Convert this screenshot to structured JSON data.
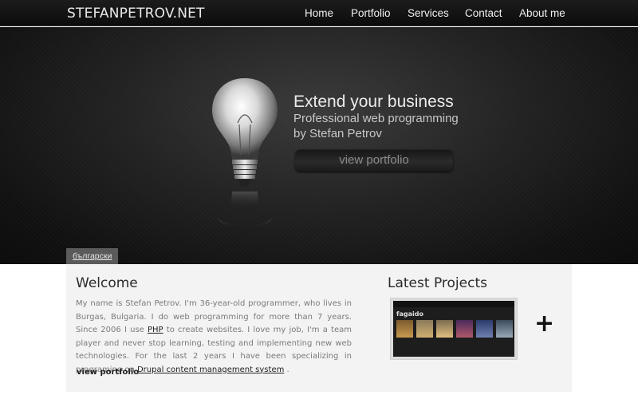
{
  "site": {
    "logo": "STEFANPETROV.NET"
  },
  "nav": {
    "items": [
      "Home",
      "Portfolio",
      "Services",
      "Contact",
      "About me"
    ]
  },
  "hero": {
    "headline": "Extend your business",
    "subtitle_line1": "Professional web programming",
    "subtitle_line2": "by Stefan Petrov",
    "button_label": "view portfolio",
    "language_label": "български"
  },
  "welcome": {
    "title": "Welcome",
    "text_before_php": "My name is Stefan Petrov. I'm 36-year-old programmer, who lives in Burgas, Bulgaria. I do web programming for more than 7 years. Since 2006 I use ",
    "php_link": "PHP",
    "text_after_php": " to create websites. I love my job, I'm a team player and never stop learning, testing and implementing new web technologies. For the last 2 years I have been specializing in programing on ",
    "drupal_link": "Drupal content management system",
    "text_end": " .",
    "view_link": "view portfolio"
  },
  "projects": {
    "title": "Latest Projects",
    "thumb_logo": "fagaido",
    "more_icon": "plus-icon",
    "more_glyph": "+"
  },
  "colors": {
    "accent": "#ffffff",
    "panel": "#f3f3f3",
    "hero_dark": "#111111"
  }
}
